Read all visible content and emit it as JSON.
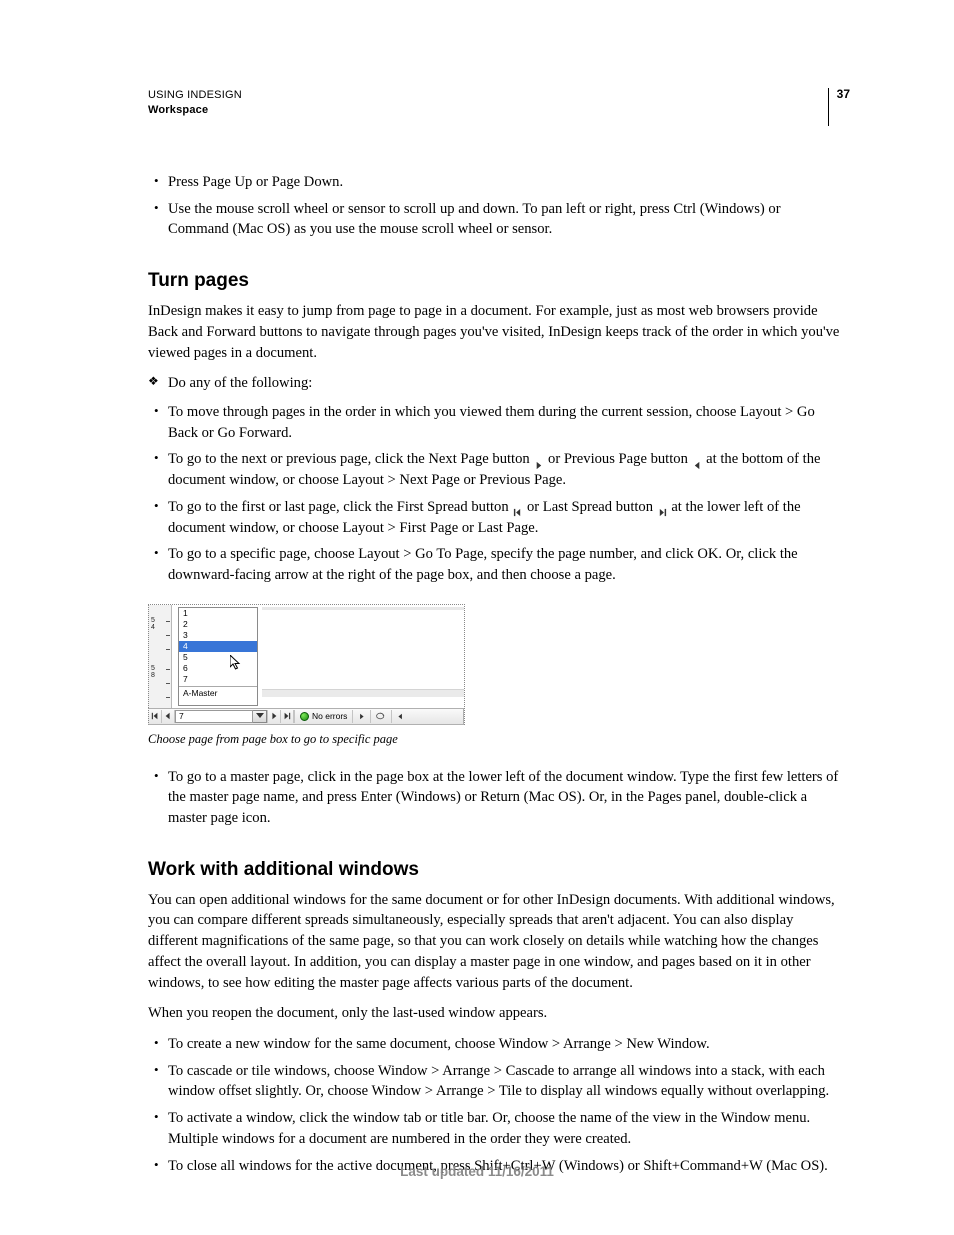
{
  "header": {
    "title": "USING INDESIGN",
    "subtitle": "Workspace",
    "page_number": "37"
  },
  "intro_bullets": [
    "Press Page Up or Page Down.",
    "Use the mouse scroll wheel or sensor to scroll up and down. To pan left or right, press Ctrl (Windows) or Command (Mac OS) as you use the mouse scroll wheel or sensor."
  ],
  "section1": {
    "heading": "Turn pages",
    "intro": "InDesign makes it easy to jump from page to page in a document. For example, just as most web browsers provide Back and Forward buttons to navigate through pages you've visited, InDesign keeps track of the order in which you've viewed pages in a document.",
    "diamond": "Do any of the following:",
    "items": {
      "i0": "To move through pages in the order in which you viewed them during the current session, choose Layout > Go Back or Go Forward.",
      "i1_a": "To go to the next or previous page, click the Next Page button ",
      "i1_b": " or Previous Page button ",
      "i1_c": " at the bottom of the document window, or choose Layout > Next Page or Previous Page.",
      "i2_a": "To go to the first or last page, click the First Spread button ",
      "i2_b": " or Last Spread button ",
      "i2_c": " at the lower left of the document window, or choose Layout > First Page or Last Page.",
      "i3": "To go to a specific page, choose Layout > Go To Page, specify the page number, and click OK. Or, click the downward-facing arrow at the right of the page box, and then choose a page.",
      "i4": "To go to a master page, click in the page box at the lower left of the document window. Type the first few letters of the master page name, and press Enter (Windows) or Return (Mac OS). Or, in the Pages panel, double-click a master page icon."
    },
    "figure": {
      "caption": "Choose page from page box to go to specific page",
      "list": [
        "1",
        "2",
        "3",
        "4",
        "5",
        "6",
        "7"
      ],
      "selected": "4",
      "master": "A-Master",
      "page_field": "7",
      "status": "No errors",
      "ruler_labels": [
        "5",
        "4",
        "5",
        "8"
      ]
    }
  },
  "section2": {
    "heading": "Work with additional windows",
    "p1": "You can open additional windows for the same document or for other InDesign documents. With additional windows, you can compare different spreads simultaneously, especially spreads that aren't adjacent. You can also display different magnifications of the same page, so that you can work closely on details while watching how the changes affect the overall layout. In addition, you can display a master page in one window, and pages based on it in other windows, to see how editing the master page affects various parts of the document.",
    "p2": "When you reopen the document, only the last-used window appears.",
    "items": [
      "To create a new window for the same document, choose Window > Arrange > New Window.",
      "To cascade or tile windows, choose Window > Arrange > Cascade to arrange all windows into a stack, with each window offset slightly. Or, choose Window > Arrange > Tile to display all windows equally without overlapping.",
      "To activate a window, click the window tab or title bar. Or, choose the name of the view in the Window menu. Multiple windows for a document are numbered in the order they were created.",
      "To close all windows for the active document, press Shift+Ctrl+W (Windows) or Shift+Command+W (Mac OS)."
    ]
  },
  "footer": "Last updated 11/16/2011"
}
